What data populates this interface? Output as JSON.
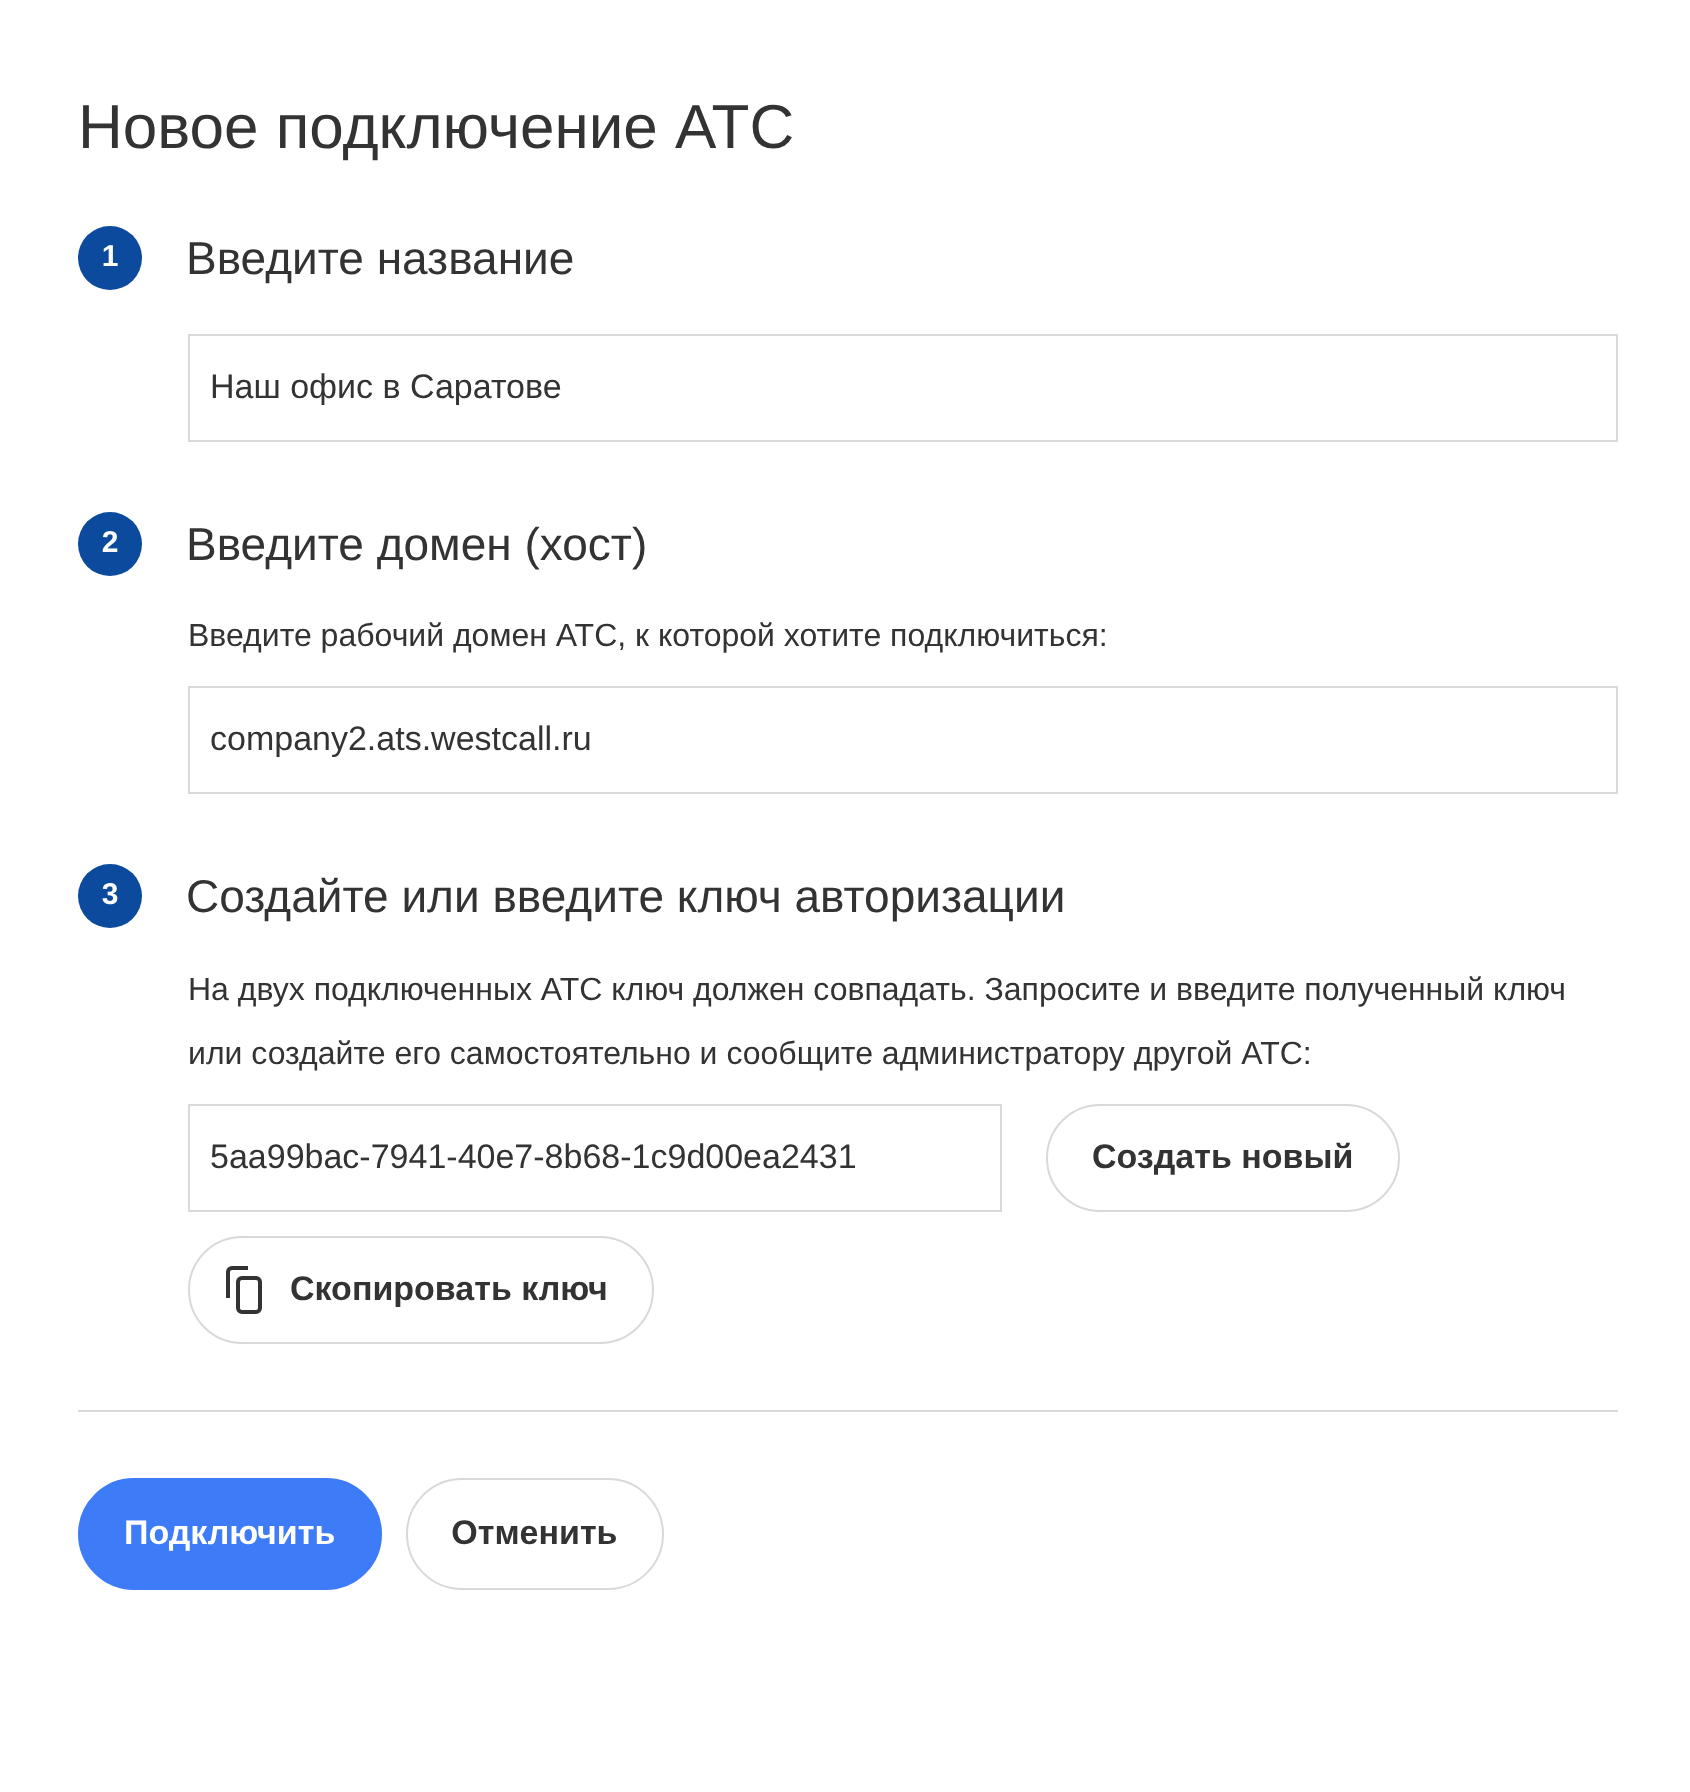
{
  "title": "Новое подключение АТС",
  "steps": [
    {
      "number": "1",
      "title": "Введите название",
      "field": {
        "value": "Наш офис в Саратове"
      }
    },
    {
      "number": "2",
      "title": "Введите домен (хост)",
      "description": "Введите рабочий домен АТС, к которой хотите подключиться:",
      "field": {
        "value": "company2.ats.westcall.ru"
      }
    },
    {
      "number": "3",
      "title": "Создайте или введите ключ авторизации",
      "description": "На двух подключенных АТС ключ должен совпадать. Запросите и введите полученный ключ или создайте его самостоятельно и сообщите администратору другой АТС:",
      "field": {
        "value": "5aa99bac-7941-40e7-8b68-1c9d00ea2431"
      },
      "inline_button": {
        "label": "Создать новый"
      },
      "extra_button": {
        "label": "Скопировать ключ",
        "kind": "copy"
      }
    }
  ],
  "footer": [
    {
      "label": "Подключить",
      "kind": "primary"
    },
    {
      "label": "Отменить",
      "kind": "secondary"
    }
  ]
}
